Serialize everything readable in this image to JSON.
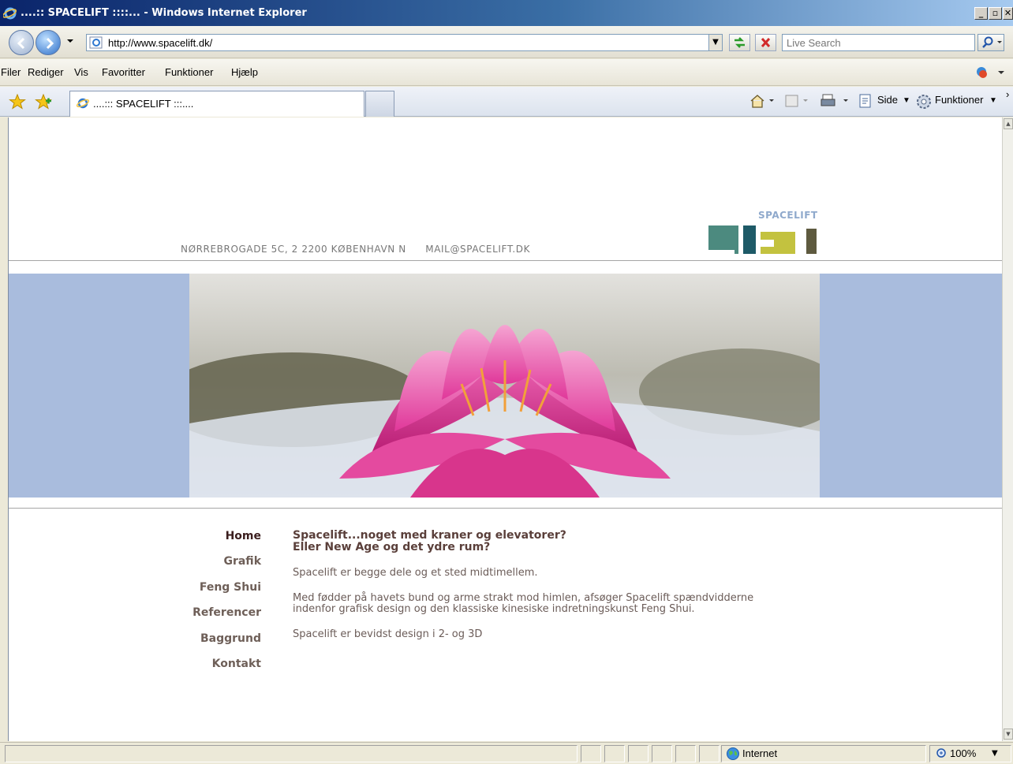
{
  "window": {
    "title": "....:: SPACELIFT ::::... - Windows Internet Explorer",
    "minimize": "_",
    "restore": "▫",
    "close": "✕"
  },
  "address_bar": {
    "url": "http://www.spacelift.dk/",
    "search_placeholder": "Live Search"
  },
  "menu": {
    "items": [
      "Filer",
      "Rediger",
      "Vis",
      "Favoritter",
      "Funktioner",
      "Hjælp"
    ]
  },
  "tabs": {
    "active_label": "....::: SPACELIFT :::...."
  },
  "command_bar": {
    "side_label": "Side",
    "tools_label": "Funktioner"
  },
  "page": {
    "contact_address": "NØRREBROGADE 5C, 2 2200 KØBENHAVN N",
    "contact_email": "MAIL@SPACELIFT.DK",
    "logo_text": "SPACELIFT",
    "nav": [
      "Home",
      "Grafik",
      "Feng Shui",
      "Referencer",
      "Baggrund",
      "Kontakt"
    ],
    "headline_line1": "Spacelift...noget med kraner og elevatorer?",
    "headline_line2": "Eller New Age og det ydre rum?",
    "paragraph1": "Spacelift er begge dele og et sted midtimellem.",
    "paragraph2_line1": "Med fødder på havets bund og arme strakt mod himlen, afsøger Spacelift spændvidderne",
    "paragraph2_line2": "indenfor grafisk design og den klassiske kinesiske indretningskunst Feng Shui.",
    "paragraph3": "Spacelift er bevidst design i 2- og 3D",
    "colors": {
      "banner_bg": "#a9bcdd",
      "logo_teal": "#4c8a7f",
      "logo_navy": "#1e5a67",
      "logo_olive": "#c3c23f",
      "logo_brown": "#5e5a3f",
      "lotus_pink": "#e9479d"
    }
  },
  "status_bar": {
    "zone": "Internet",
    "zoom": "100%"
  }
}
